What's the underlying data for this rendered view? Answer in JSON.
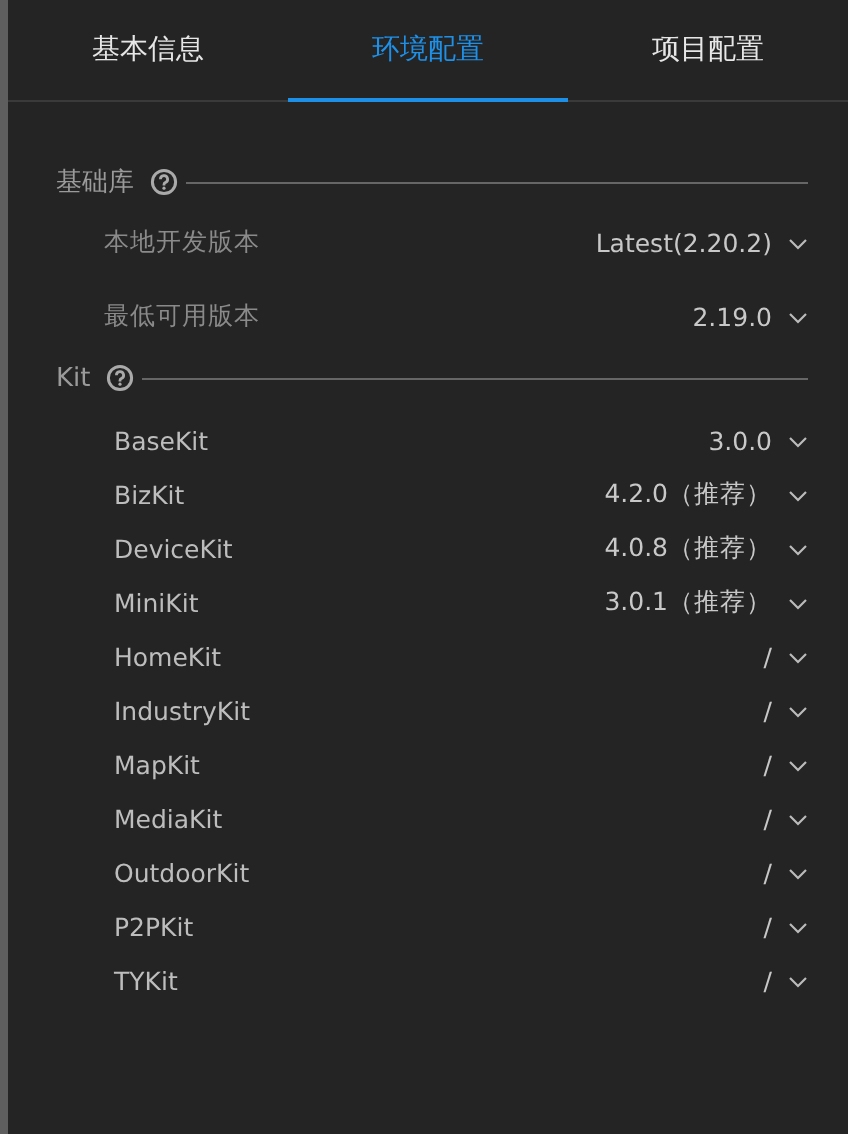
{
  "tabs": [
    {
      "label": "基本信息",
      "selected": false
    },
    {
      "label": "环境配置",
      "selected": true
    },
    {
      "label": "项目配置",
      "selected": false
    }
  ],
  "sections": [
    {
      "title": "基础库",
      "rows": [
        {
          "label": "本地开发版本",
          "value": "Latest(2.20.2)"
        },
        {
          "label": "最低可用版本",
          "value": "2.19.0"
        }
      ]
    },
    {
      "title": "Kit",
      "rows": [
        {
          "label": "BaseKit",
          "value": "3.0.0"
        },
        {
          "label": "BizKit",
          "value": "4.2.0（推荐）"
        },
        {
          "label": "DeviceKit",
          "value": "4.0.8（推荐）"
        },
        {
          "label": "MiniKit",
          "value": "3.0.1（推荐）"
        },
        {
          "label": "HomeKit",
          "value": "/"
        },
        {
          "label": "IndustryKit",
          "value": "/"
        },
        {
          "label": "MapKit",
          "value": "/"
        },
        {
          "label": "MediaKit",
          "value": "/"
        },
        {
          "label": "OutdoorKit",
          "value": "/"
        },
        {
          "label": "P2PKit",
          "value": "/"
        },
        {
          "label": "TYKit",
          "value": "/"
        }
      ]
    }
  ]
}
